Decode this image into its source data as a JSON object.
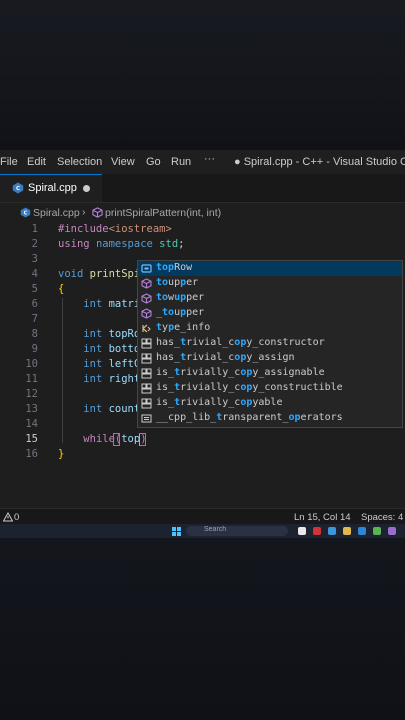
{
  "menubar": {
    "items": [
      "File",
      "Edit",
      "Selection",
      "View",
      "Go",
      "Run"
    ],
    "overflow": "···",
    "window_title": "● Spiral.cpp - C++ - Visual Studio Code"
  },
  "tab": {
    "label": "Spiral.cpp",
    "modified": true
  },
  "breadcrumb": {
    "file": "Spiral.cpp",
    "separator": "›",
    "symbol": "printSpiralPattern(int, int)"
  },
  "editor": {
    "line_numbers": [
      "1",
      "2",
      "3",
      "4",
      "5",
      "6",
      "7",
      "8",
      "9",
      "10",
      "11",
      "12",
      "13",
      "14",
      "15",
      "16"
    ],
    "active_line": "15",
    "tokens": {
      "include": "#include",
      "header": "<iostream>",
      "using": "using",
      "namespace": "namespace",
      "std": "std",
      "semicolon": ";",
      "void": "void",
      "func_partial": "printSpi",
      "open_brace": "{",
      "close_brace": "}",
      "int": "int",
      "matri": "matri",
      "topRo": "topRo",
      "botto": "botto",
      "leftC": "leftC",
      "right": "right",
      "count": "count",
      "while": "while",
      "open_paren": "(",
      "top": "top",
      "close_paren": ")"
    }
  },
  "suggest": {
    "items": [
      {
        "kind": "variable",
        "pre": "",
        "match": "top",
        "post": "Row"
      },
      {
        "kind": "function",
        "pre": "",
        "match": "to",
        "post": "up",
        "match2": "p",
        "post2": "er"
      },
      {
        "kind": "function",
        "pre": "",
        "match": "to",
        "post": "w",
        "match2": "up",
        "post2": "per"
      },
      {
        "kind": "function",
        "pre": "_",
        "match": "to",
        "post": "u",
        "match2": "p",
        "post2": "per"
      },
      {
        "kind": "keyword",
        "pre": "",
        "match": "t",
        "post": "y",
        "match2": "p",
        "post2": "e_info"
      },
      {
        "kind": "struct",
        "pre": "has_",
        "match": "t",
        "post": "rivial_c",
        "match2": "op",
        "post2": "y_constructor"
      },
      {
        "kind": "struct",
        "pre": "has_",
        "match": "t",
        "post": "rivial_c",
        "match2": "op",
        "post2": "y_assign"
      },
      {
        "kind": "struct",
        "pre": "is_",
        "match": "t",
        "post": "rivially_c",
        "match2": "op",
        "post2": "y_assignable"
      },
      {
        "kind": "struct",
        "pre": "is_",
        "match": "t",
        "post": "rivially_c",
        "match2": "op",
        "post2": "y_constructible"
      },
      {
        "kind": "struct",
        "pre": "is_",
        "match": "t",
        "post": "rivially_c",
        "match2": "op",
        "post2": "yable"
      },
      {
        "kind": "macro",
        "pre": "__cpp_lib_",
        "match": "t",
        "post": "ransparent_",
        "match2": "op",
        "post2": "erators"
      }
    ]
  },
  "statusbar": {
    "warnings": "0",
    "position": "Ln 15, Col 14",
    "spaces": "Spaces: 4"
  },
  "taskbar": {
    "search_placeholder": "Search"
  },
  "colors": {
    "editor_bg": "#1e1e1e",
    "accent": "#0078d4",
    "suggest_bg": "#252526",
    "suggest_selected": "#04395e",
    "match_highlight": "#2aaaff",
    "keyword": "#569cd6",
    "preprocessor": "#c586c0",
    "string": "#ce9178",
    "variable": "#9cdcfe",
    "function": "#dcdcaa",
    "brace": "#ffd700"
  }
}
